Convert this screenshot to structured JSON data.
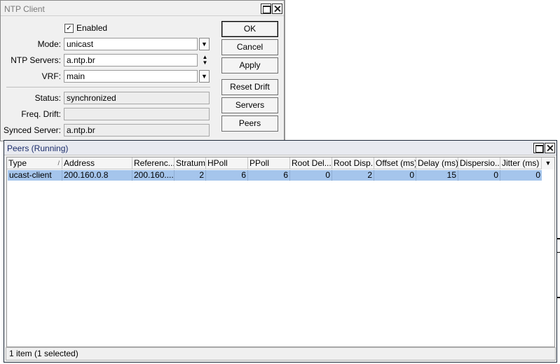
{
  "ntp_client": {
    "title": "NTP Client",
    "enabled_label": "Enabled",
    "enabled_checked": true,
    "fields": {
      "mode_label": "Mode:",
      "mode_value": "unicast",
      "ntp_servers_label": "NTP Servers:",
      "ntp_servers_value": "a.ntp.br",
      "vrf_label": "VRF:",
      "vrf_value": "main",
      "status_label": "Status:",
      "status_value": "synchronized",
      "freq_drift_label": "Freq. Drift:",
      "freq_drift_value": "",
      "synced_server_label": "Synced Server:",
      "synced_server_value": "a.ntp.br"
    },
    "buttons": {
      "ok": "OK",
      "cancel": "Cancel",
      "apply": "Apply",
      "reset_drift": "Reset Drift",
      "servers": "Servers",
      "peers": "Peers"
    }
  },
  "peers_window": {
    "title": "Peers (Running)",
    "columns": [
      "Type",
      "Address",
      "Referenc...",
      "Stratum",
      "HPoll",
      "PPoll",
      "Root Del...",
      "Root Disp...",
      "Offset (ms)",
      "Delay (ms)",
      "Dispersio...",
      "Jitter (ms)"
    ],
    "rows": [
      {
        "type": "ucast-client",
        "address": "200.160.0.8",
        "reference": "200.160....",
        "stratum": "2",
        "hpoll": "6",
        "ppoll": "6",
        "root_delay": "0",
        "root_dispersion": "2",
        "offset": "0",
        "delay": "15",
        "dispersion": "0",
        "jitter": "0",
        "selected": true
      }
    ],
    "status": "1 item (1 selected)"
  },
  "colors": {
    "selection": "#a5c5ec",
    "window_bg": "#f0f0f0",
    "peers_title": "#1a2b6a"
  }
}
